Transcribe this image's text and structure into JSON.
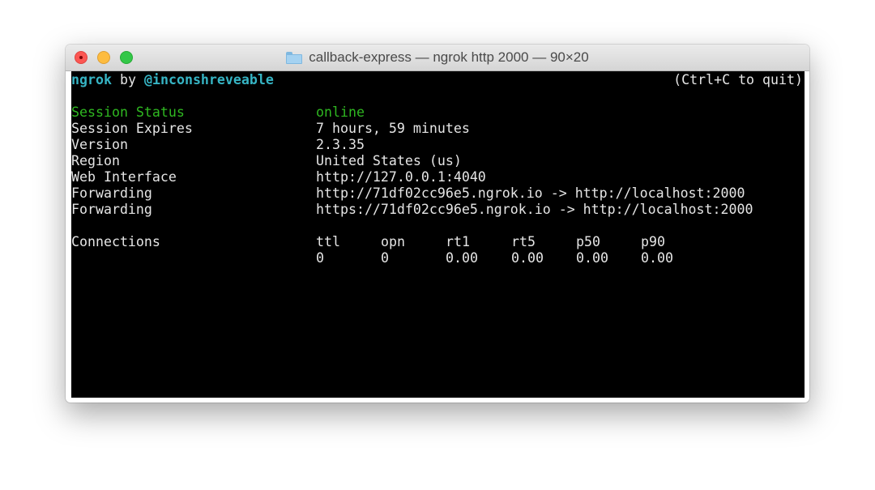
{
  "window": {
    "title": "callback-express — ngrok http 2000 — 90×20"
  },
  "header": {
    "app": "ngrok",
    "by": "by",
    "author": "@inconshreveable",
    "quit_hint": "(Ctrl+C to quit)"
  },
  "status_rows": [
    {
      "label": "Session Status",
      "value": "online"
    },
    {
      "label": "Session Expires",
      "value": "7 hours, 59 minutes"
    },
    {
      "label": "Version",
      "value": "2.3.35"
    },
    {
      "label": "Region",
      "value": "United States (us)"
    },
    {
      "label": "Web Interface",
      "value": "http://127.0.0.1:4040"
    },
    {
      "label": "Forwarding",
      "value": "http://71df02cc96e5.ngrok.io -> http://localhost:2000"
    },
    {
      "label": "Forwarding",
      "value": "https://71df02cc96e5.ngrok.io -> http://localhost:2000"
    }
  ],
  "connections": {
    "label": "Connections",
    "columns": [
      "ttl",
      "opn",
      "rt1",
      "rt5",
      "p50",
      "p90"
    ],
    "values": [
      "0",
      "0",
      "0.00",
      "0.00",
      "0.00",
      "0.00"
    ]
  },
  "colors": {
    "terminal_bg": "#000000",
    "text": "#e5e5e5",
    "accent_cyan": "#36b4c4",
    "status_green": "#2fb821"
  }
}
